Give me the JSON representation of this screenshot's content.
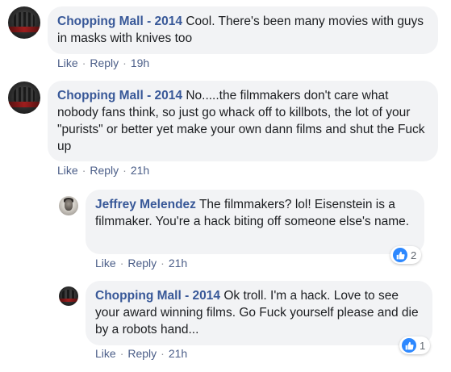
{
  "comments": [
    {
      "author": "Chopping Mall - 2014",
      "text": "Cool. There's been many movies with guys in masks with knives too",
      "like": "Like",
      "reply": "Reply",
      "time": "19h"
    },
    {
      "author": "Chopping Mall - 2014",
      "text": "No.....the filmmakers don't care what nobody fans think, so just go whack off to killbots, the lot of your \"purists\" or better yet make your own dann films and shut the Fuck up",
      "like": "Like",
      "reply": "Reply",
      "time": "21h"
    }
  ],
  "replies": [
    {
      "author": "Jeffrey Melendez",
      "text": "The filmmakers? lol! Eisenstein is a filmmaker. You're a hack biting off someone else's name.",
      "like": "Like",
      "reply": "Reply",
      "time": "21h",
      "reaction_count": "2"
    },
    {
      "author": "Chopping Mall - 2014",
      "text": "Ok troll. I'm a hack. Love to see your award winning films. Go Fuck yourself please and die by a robots hand...",
      "like": "Like",
      "reply": "Reply",
      "time": "21h",
      "reaction_count": "1"
    }
  ],
  "icons": {
    "reaction": "thumbs-up-icon",
    "separator": "·"
  },
  "colors": {
    "author": "#385898",
    "bubble": "#f2f3f5",
    "like_badge": "#2d88ff"
  }
}
